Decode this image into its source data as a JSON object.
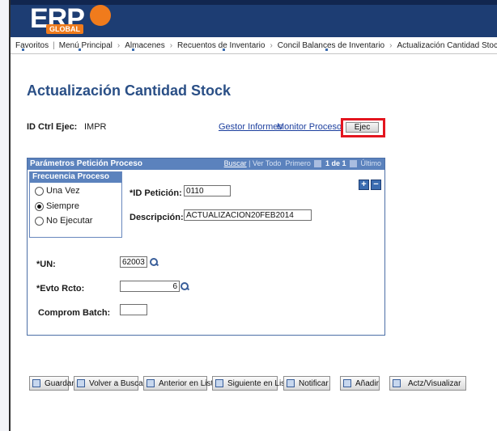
{
  "app": {
    "logo_text": "ERP",
    "logo_sub": "GLOBAL"
  },
  "breadcrumb": {
    "items": [
      "Favoritos",
      "Menú Principal",
      "Almacenes",
      "Recuentos de Inventario",
      "Concil Balances de Inventario",
      "Actualización Cantidad Stock"
    ]
  },
  "page": {
    "title": "Actualización Cantidad Stock"
  },
  "run_control": {
    "label": "ID Ctrl Ejec:",
    "value": "IMPR",
    "report_manager": "Gestor Informes",
    "process_monitor": "Monitor Procesos",
    "run_button": "Ejec"
  },
  "panel": {
    "title": "Parámetros Petición Proceso",
    "nav": {
      "find": "Buscar",
      "view_all": "Ver Todo",
      "first": "Primero",
      "count": "1 de 1",
      "last": "Último"
    },
    "frequency": {
      "title": "Frecuencia Proceso",
      "options": [
        "Una Vez",
        "Siempre",
        "No Ejecutar"
      ],
      "selected": "Siempre"
    },
    "request_id": {
      "label": "*ID Petición:",
      "value": "0110"
    },
    "description": {
      "label": "Descripción:",
      "value": "ACTUALIZACION20FEB2014"
    },
    "un": {
      "label": "*UN:",
      "value": "62003"
    },
    "event": {
      "label": "*Evto Rcto:",
      "value": "6"
    },
    "batch": {
      "label": "Comprom Batch:",
      "value": ""
    },
    "add_row": "+",
    "delete_row": "−"
  },
  "toolbar": {
    "save": "Guardar",
    "return_to_search": "Volver a Buscar",
    "previous": "Anterior en Lista",
    "next": "Siguiente en Lista",
    "notify": "Notificar",
    "add": "Añadir",
    "update_display": "Actz/Visualizar"
  },
  "colors": {
    "header_bg": "#1d3d73",
    "panel_header": "#5b82bd",
    "title": "#2a4f86",
    "run_highlight": "#e3161f",
    "logo_accent": "#f07b1c"
  }
}
